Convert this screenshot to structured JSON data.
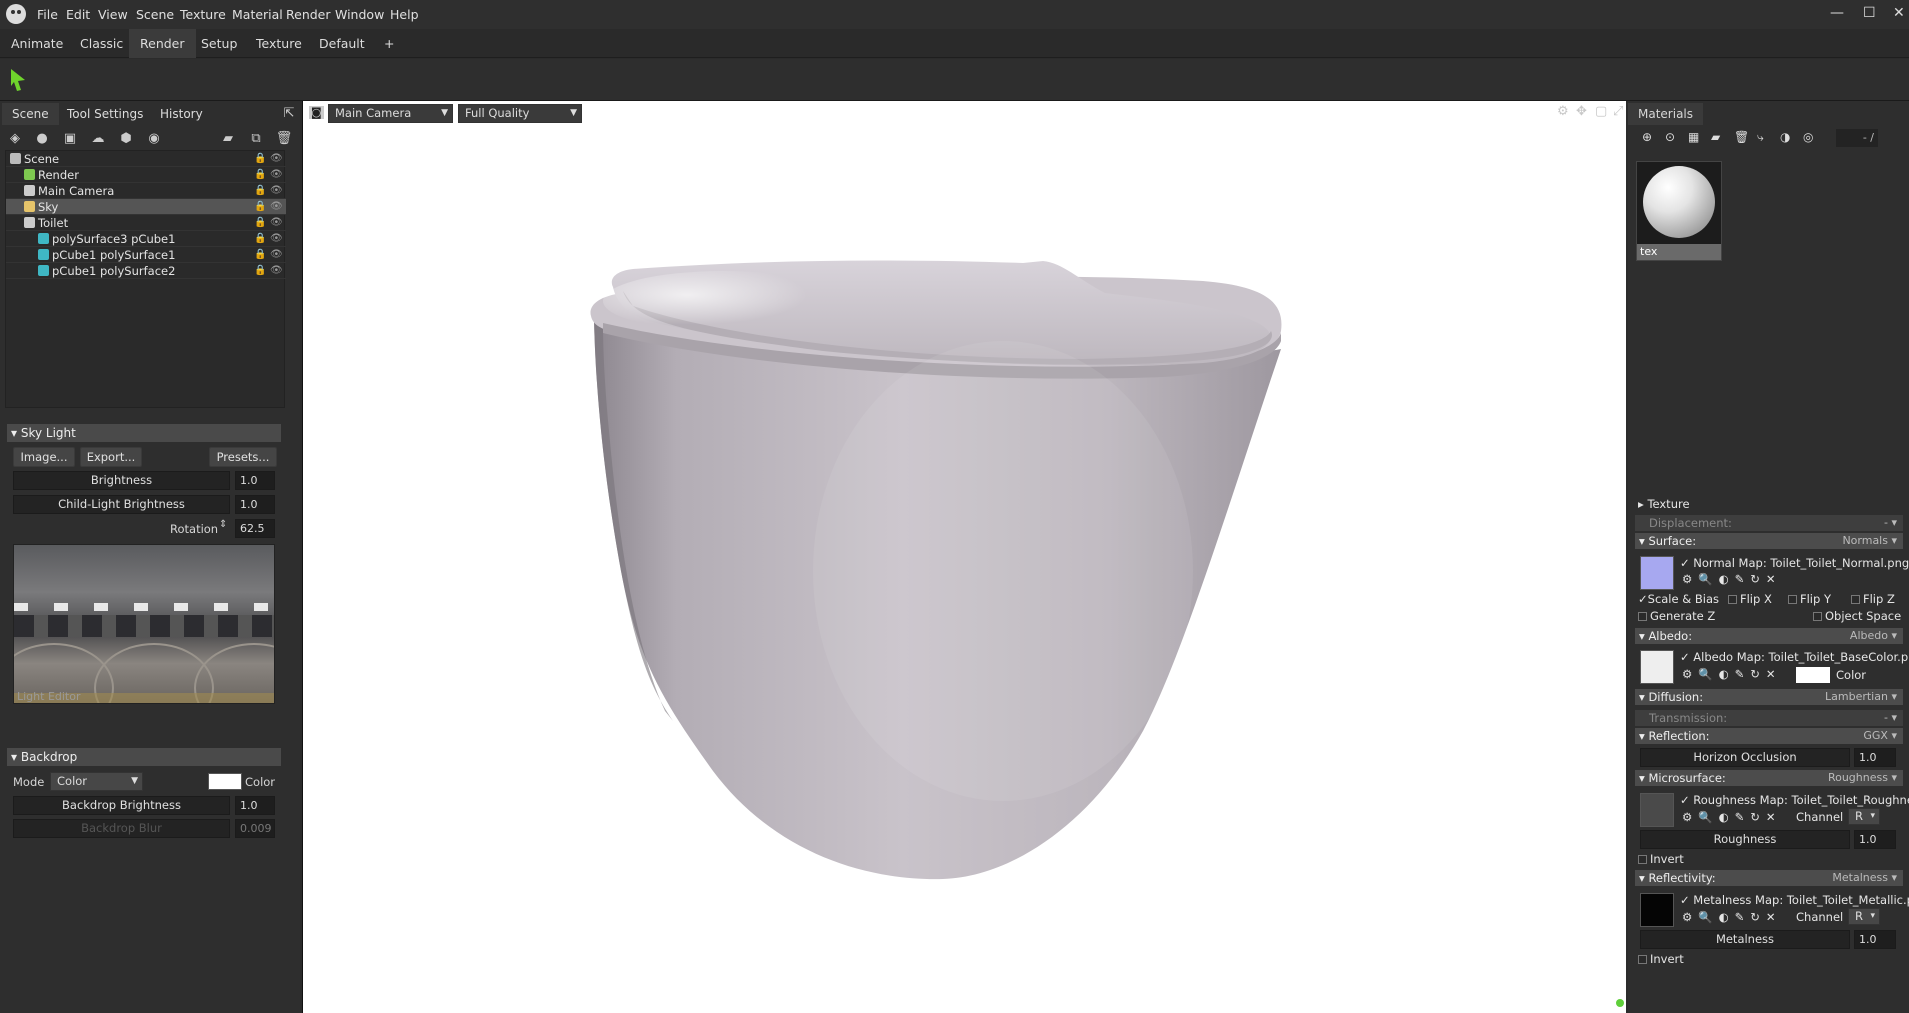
{
  "menubar": {
    "items": [
      "File",
      "Edit",
      "View",
      "Scene",
      "Texture",
      "Material",
      "Render",
      "Window",
      "Help"
    ],
    "win_controls": [
      "—",
      "☐",
      "✕"
    ]
  },
  "workspace_tabs": [
    "Animate",
    "Classic",
    "Render",
    "Setup",
    "Texture",
    "Default",
    "+"
  ],
  "active_workspace": "Render",
  "left_panel": {
    "tabs": [
      "Scene",
      "Tool Settings",
      "History"
    ],
    "tree": [
      {
        "label": "Scene",
        "icon": "scene-icon",
        "color": "#bbbbbb",
        "depth": 0,
        "selected": false
      },
      {
        "label": "Render",
        "icon": "render-icon",
        "color": "#7ec850",
        "depth": 1,
        "selected": false
      },
      {
        "label": "Main Camera",
        "icon": "camera-icon",
        "color": "#cccccc",
        "depth": 1,
        "selected": false
      },
      {
        "label": "Sky",
        "icon": "sky-icon",
        "color": "#e6c46a",
        "depth": 1,
        "selected": true
      },
      {
        "label": "Toilet",
        "icon": "object-icon",
        "color": "#cccccc",
        "depth": 1,
        "selected": false
      },
      {
        "label": "polySurface3 pCube1",
        "icon": "mesh-icon",
        "color": "#3fb7c4",
        "depth": 2,
        "selected": false
      },
      {
        "label": "pCube1 polySurface1",
        "icon": "mesh-icon",
        "color": "#3fb7c4",
        "depth": 2,
        "selected": false
      },
      {
        "label": "pCube1 polySurface2",
        "icon": "mesh-icon",
        "color": "#3fb7c4",
        "depth": 2,
        "selected": false
      }
    ],
    "sky_light": {
      "title": "Sky Light",
      "buttons": [
        "Image...",
        "Export...",
        "Presets..."
      ],
      "brightness_label": "Brightness",
      "brightness_value": "1.0",
      "child_light_label": "Child-Light Brightness",
      "child_light_value": "1.0",
      "rotation_label": "Rotation",
      "rotation_value": "62.5",
      "preview_caption": "Light Editor"
    },
    "backdrop": {
      "title": "Backdrop",
      "mode_label": "Mode",
      "mode_value": "Color",
      "color_label": "Color",
      "color_swatch": "#ffffff",
      "brightness_label": "Backdrop Brightness",
      "brightness_value": "1.0",
      "blur_label": "Backdrop Blur",
      "blur_value": "0.009"
    }
  },
  "viewport": {
    "camera": "Main Camera",
    "quality": "Full Quality",
    "background": "#ffffff"
  },
  "right_panel": {
    "title": "Materials",
    "counter": "- /",
    "material_name": "tex",
    "sections": {
      "texture": "Texture",
      "displacement": {
        "label": "Displacement:",
        "value": "-"
      },
      "surface": {
        "label": "Surface:",
        "value": "Normals"
      },
      "normal_map_label": "Normal Map:",
      "normal_map_file": "Toilet_Toilet_Normal.png",
      "scale_bias": "Scale & Bias",
      "flip_x": "Flip X",
      "flip_y": "Flip Y",
      "flip_z": "Flip Z",
      "generate_z": "Generate Z",
      "object_space": "Object Space",
      "albedo": {
        "label": "Albedo:",
        "value": "Albedo"
      },
      "albedo_map_label": "Albedo Map:",
      "albedo_map_file": "Toilet_Toilet_BaseColor.pn",
      "albedo_color_label": "Color",
      "diffusion": {
        "label": "Diffusion:",
        "value": "Lambertian"
      },
      "transmission": {
        "label": "Transmission:",
        "value": "-"
      },
      "reflection": {
        "label": "Reflection:",
        "value": "GGX"
      },
      "horizon_occlusion_label": "Horizon Occlusion",
      "horizon_occlusion_value": "1.0",
      "microsurface": {
        "label": "Microsurface:",
        "value": "Roughness"
      },
      "roughness_map_label": "Roughness Map:",
      "roughness_map_file": "Toilet_Toilet_Roughne:",
      "roughness_channel_label": "Channel",
      "roughness_channel_value": "R",
      "roughness_label": "Roughness",
      "roughness_value": "1.0",
      "roughness_invert": "Invert",
      "reflectivity": {
        "label": "Reflectivity:",
        "value": "Metalness"
      },
      "metalness_map_label": "Metalness Map:",
      "metalness_map_file": "Toilet_Toilet_Metallic.pi",
      "metalness_channel_label": "Channel",
      "metalness_channel_value": "R",
      "metalness_label": "Metalness",
      "metalness_value": "1.0",
      "metalness_invert": "Invert"
    }
  }
}
